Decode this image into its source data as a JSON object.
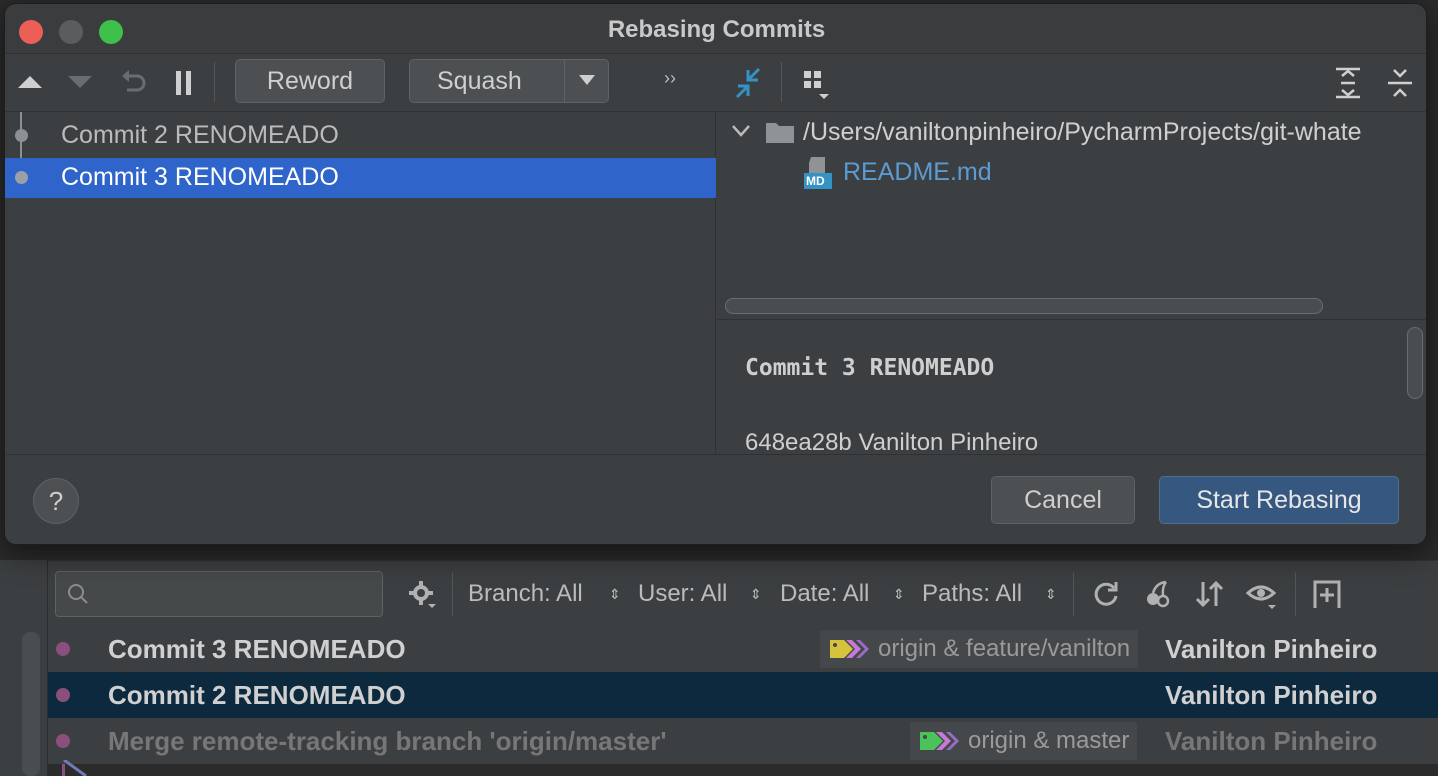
{
  "dialog": {
    "title": "Rebasing Commits",
    "traffic_lights": {
      "close": "#ec5f57",
      "minimize": "#5a5c5e",
      "maximize": "#3fc04a"
    }
  },
  "left_toolbar": {
    "reword_label": "Reword",
    "squash_label": "Squash",
    "more_glyph": "››"
  },
  "commits": [
    {
      "label": "Commit 2 RENOMEADO",
      "selected": false
    },
    {
      "label": "Commit 3 RENOMEADO",
      "selected": true
    }
  ],
  "file_tree": {
    "folder_path": "/Users/vaniltonpinheiro/PycharmProjects/git-whate",
    "files": [
      {
        "name": "README.md",
        "icon_text": "MD"
      }
    ]
  },
  "details": {
    "commit_title": "Commit 3 RENOMEADO",
    "hash_author": "648ea28b Vanilton Pinheiro"
  },
  "footer": {
    "help_glyph": "?",
    "cancel_label": "Cancel",
    "start_label": "Start Rebasing"
  },
  "log": {
    "filters": {
      "branch": "Branch: All",
      "user": "User: All",
      "date": "Date: All",
      "paths": "Paths: All"
    },
    "rows": [
      {
        "message": "Commit 3 RENOMEADO",
        "tag": "origin & feature/vanilton",
        "author": "Vanilton Pinheiro",
        "style": "normal"
      },
      {
        "message": "Commit 2 RENOMEADO",
        "tag": "",
        "author": "Vanilton Pinheiro",
        "style": "selected"
      },
      {
        "message": "Merge remote-tracking branch 'origin/master'",
        "tag": "origin & master",
        "author": "Vanilton Pinheiro",
        "style": "dim"
      }
    ]
  },
  "colors": {
    "selection_blue": "#2f65ca",
    "log_selection": "#0d293e",
    "accent_button": "#365880",
    "file_link": "#5c9bd1",
    "graph_node": "#8a4f7d"
  }
}
